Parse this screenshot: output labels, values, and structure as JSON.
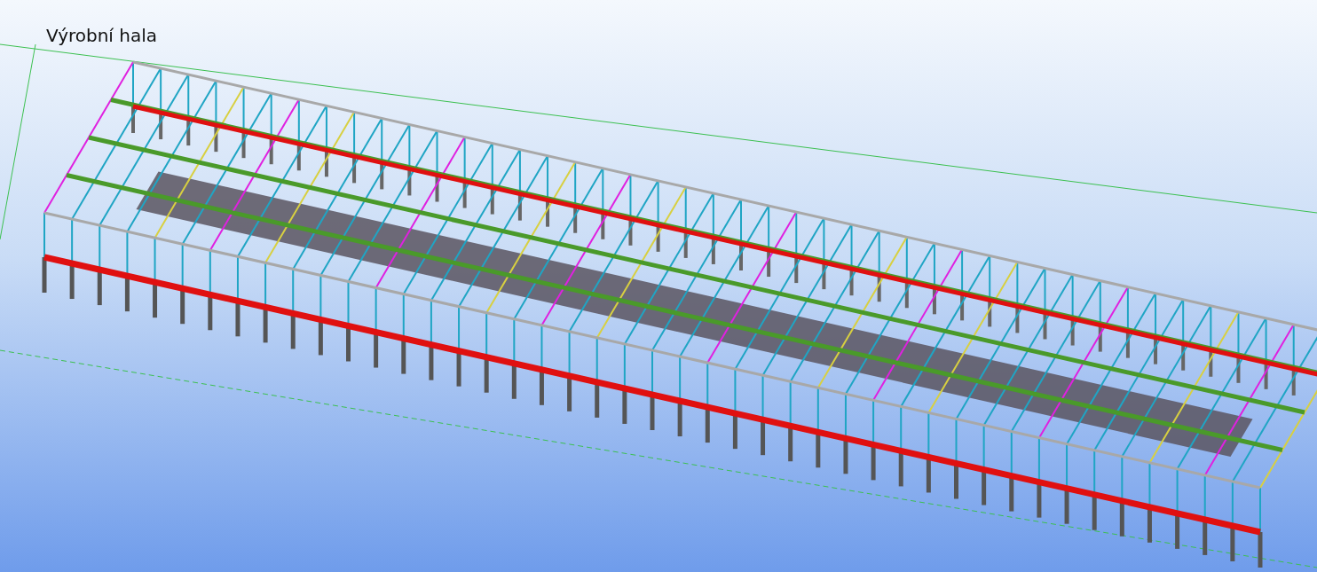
{
  "viewport": {
    "title": "Výrobní hala"
  }
}
